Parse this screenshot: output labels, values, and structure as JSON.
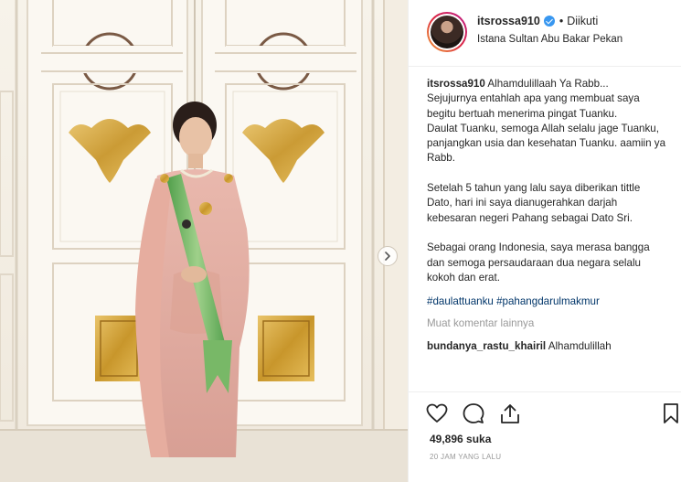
{
  "post": {
    "username": "itsrossa910",
    "verified": true,
    "follow_status": "Diikuti",
    "location": "Istana Sultan Abu Bakar Pekan",
    "caption_username": "itsrossa910",
    "caption_text": "Alhamdulillaah Ya Rabb...\nSejujurnya entahlah apa yang membuat saya begitu bertuah menerima pingat Tuanku.\nDaulat Tuanku, semoga Allah selalu jage Tuanku, panjangkan usia dan kesehatan Tuanku. aamiin ya Rabb.\n\nSetelah 5 tahun yang lalu saya diberikan tittle Dato, hari ini saya dianugerahkan darjah kebesaran negeri Pahang sebagai Dato Sri.\n\nSebagai orang Indonesia, saya merasa bangga dan semoga persaudaraan dua negara selalu kokoh dan erat.",
    "hashtags": "#daulattuanku #pahangdarulmakmur",
    "view_more_comments": "Muat komentar lainnya",
    "next_comment_user": "bundanya_rastu_khairil",
    "next_comment_text": "Alhamdulillah",
    "likes": "49,896 suka",
    "timestamp": "20 JAM YANG LALU"
  },
  "icons": {
    "like": "heart-icon",
    "comment": "comment-icon",
    "share": "share-icon",
    "save": "bookmark-icon",
    "next": "chevron-right-icon",
    "verified": "verified-badge-icon"
  },
  "colors": {
    "link_blue": "#003569",
    "verified_blue": "#3897f0",
    "muted_gray": "#999999",
    "text": "#262626",
    "border": "#efefef"
  }
}
